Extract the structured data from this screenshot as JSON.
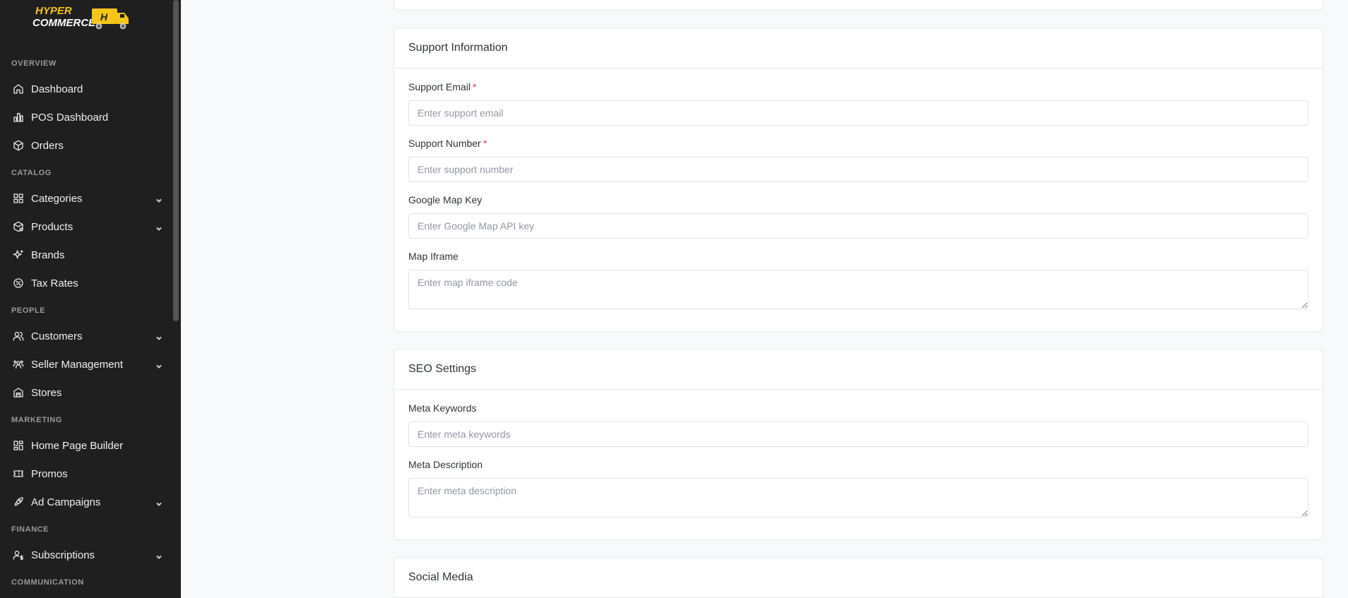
{
  "brand": {
    "line1": "HYPER",
    "line2": "COMMERCE",
    "badge": "H"
  },
  "sidebar": {
    "sections": {
      "overview": "OVERVIEW",
      "catalog": "CATALOG",
      "people": "PEOPLE",
      "marketing": "MARKETING",
      "finance": "FINANCE",
      "communication": "COMMUNICATION"
    },
    "items": [
      {
        "label": "Dashboard",
        "icon": "home-icon"
      },
      {
        "label": "POS Dashboard",
        "icon": "bar-chart-icon"
      },
      {
        "label": "Orders",
        "icon": "box-icon"
      },
      {
        "label": "Categories",
        "icon": "grid-icon"
      },
      {
        "label": "Products",
        "icon": "package-icon"
      },
      {
        "label": "Brands",
        "icon": "sparkles-icon"
      },
      {
        "label": "Tax Rates",
        "icon": "percent-badge-icon"
      },
      {
        "label": "Customers",
        "icon": "users-icon"
      },
      {
        "label": "Seller Management",
        "icon": "user-group-icon"
      },
      {
        "label": "Stores",
        "icon": "store-icon"
      },
      {
        "label": "Home Page Builder",
        "icon": "layout-icon"
      },
      {
        "label": "Promos",
        "icon": "ticket-icon"
      },
      {
        "label": "Ad Campaigns",
        "icon": "rocket-icon"
      },
      {
        "label": "Subscriptions",
        "icon": "user-dollar-icon"
      }
    ]
  },
  "support": {
    "title": "Support Information",
    "email_label": "Support Email",
    "email_placeholder": "Enter support email",
    "number_label": "Support Number",
    "number_placeholder": "Enter support number",
    "map_key_label": "Google Map Key",
    "map_key_placeholder": "Enter Google Map API key",
    "iframe_label": "Map Iframe",
    "iframe_placeholder": "Enter map iframe code",
    "required_mark": "*"
  },
  "seo": {
    "title": "SEO Settings",
    "keywords_label": "Meta Keywords",
    "keywords_placeholder": "Enter meta keywords",
    "description_label": "Meta Description",
    "description_placeholder": "Enter meta description"
  },
  "social": {
    "title": "Social Media"
  },
  "colors": {
    "sidebar_bg": "#1f1f1f",
    "brand_yellow": "#f5c518",
    "required_red": "#e03b3b"
  }
}
